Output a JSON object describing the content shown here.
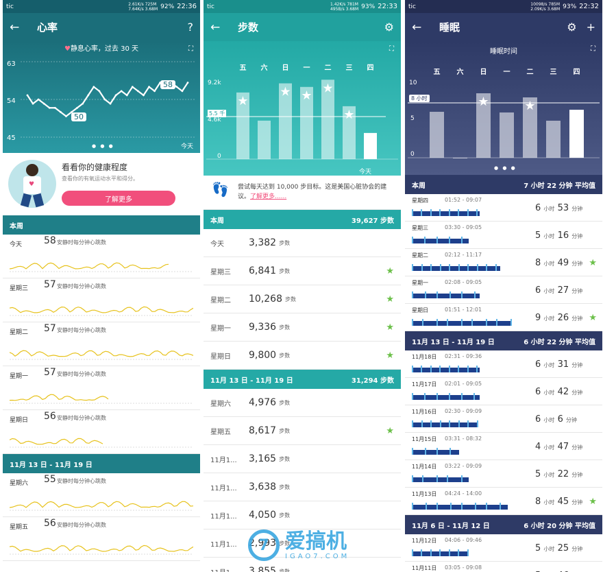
{
  "heart": {
    "status": {
      "carrier": "tic",
      "net": "2.61K/s 725M",
      "net2": "7.64K/s 3.68M",
      "battery": "92%",
      "time": "22:36"
    },
    "title": "心率",
    "help": "?",
    "chart_caption": "静息心率，过去 30 天",
    "y_ticks": [
      "63",
      "54",
      "45"
    ],
    "bubble_low": "50",
    "bubble_high": "58",
    "today": "今天",
    "chart_data": {
      "type": "line",
      "ylim": [
        45,
        63
      ],
      "values": [
        55,
        53,
        54,
        53,
        52,
        52,
        51,
        50,
        51,
        52,
        53,
        55,
        57,
        56,
        54,
        53,
        55,
        56,
        55,
        57,
        56,
        55,
        57,
        56,
        58,
        57,
        58,
        57,
        56,
        58
      ]
    },
    "promo": {
      "title": "看看你的健康程度",
      "desc": "查看你的有氧运动水平和得分。",
      "button": "了解更多"
    },
    "week_label": "本周",
    "unit": "安静时每分钟心跳数",
    "rows": [
      {
        "label": "今天",
        "value": "58",
        "fill": 0.87
      },
      {
        "label": "星期三",
        "value": "57",
        "fill": 1
      },
      {
        "label": "星期二",
        "value": "57",
        "fill": 1
      },
      {
        "label": "星期一",
        "value": "57",
        "fill": 0.55
      },
      {
        "label": "星期日",
        "value": "56",
        "fill": 0.52
      }
    ],
    "week2_label": "11月 13 日 - 11月 19 日",
    "rows2": [
      {
        "label": "星期六",
        "value": "55",
        "fill": 1
      },
      {
        "label": "星期五",
        "value": "56",
        "fill": 1
      }
    ]
  },
  "steps": {
    "status": {
      "carrier": "tic",
      "net": "1.42K/s 781M",
      "net2": "495B/s 3.68M",
      "battery": "93%",
      "time": "22:33"
    },
    "title": "步数",
    "days": [
      "五",
      "六",
      "日",
      "一",
      "二",
      "三",
      "四"
    ],
    "y_ticks": [
      "9.2k",
      "4.6k",
      "0"
    ],
    "goal_label": "5.5 千",
    "today": "今天",
    "chart_data": {
      "type": "bar",
      "categories": [
        "五",
        "六",
        "日",
        "一",
        "二",
        "三",
        "四"
      ],
      "values": [
        8617,
        4976,
        9800,
        9336,
        10268,
        6841,
        3382
      ],
      "ylim": [
        0,
        11000
      ],
      "goal": 5500
    },
    "tip": {
      "text": "尝试每天达到 10,000 步目标。这是美国心脏协会的建议。",
      "link": "了解更多......"
    },
    "week_label": "本周",
    "week_total": "39,627 步数",
    "unit": "步数",
    "rows": [
      {
        "label": "今天",
        "value": "3,382",
        "star": false
      },
      {
        "label": "星期三",
        "value": "6,841",
        "star": true
      },
      {
        "label": "星期二",
        "value": "10,268",
        "star": true
      },
      {
        "label": "星期一",
        "value": "9,336",
        "star": true
      },
      {
        "label": "星期日",
        "value": "9,800",
        "star": true
      }
    ],
    "week2_label": "11月 13 日 - 11月 19 日",
    "week2_total": "31,294 步数",
    "rows2": [
      {
        "label": "星期六",
        "value": "4,976",
        "star": false
      },
      {
        "label": "星期五",
        "value": "8,617",
        "star": true
      },
      {
        "label": "11月1...",
        "value": "3,165",
        "star": false
      },
      {
        "label": "11月1...",
        "value": "3,638",
        "star": false
      },
      {
        "label": "11月1...",
        "value": "4,050",
        "star": false
      },
      {
        "label": "11月1...",
        "value": "2,993",
        "star": false
      },
      {
        "label": "11月1...",
        "value": "3,855",
        "star": false
      }
    ]
  },
  "sleep": {
    "status": {
      "carrier": "tic",
      "net": "10098/s 785M",
      "net2": "2.09K/s 3.68M",
      "battery": "93%",
      "time": "22:32"
    },
    "title": "睡眠",
    "caption": "睡眠时间",
    "days": [
      "五",
      "六",
      "日",
      "一",
      "二",
      "三",
      "四"
    ],
    "y_ticks": [
      "10",
      "5",
      "0"
    ],
    "goal_label": "8 小时",
    "chart_data": {
      "type": "bar",
      "categories": [
        "五",
        "六",
        "日",
        "一",
        "二",
        "三",
        "四"
      ],
      "values": [
        6.7,
        0,
        9.4,
        6.6,
        8.8,
        5.4,
        7.0
      ],
      "ylim": [
        0,
        11
      ],
      "goal": 8
    },
    "hours_unit": "小时",
    "min_unit": "分钟",
    "week_label": "本周",
    "week_avg": "7 小时 22 分钟 平均值",
    "rows": [
      {
        "label": "星期四",
        "time": "01:52 - 09:07",
        "h": "6",
        "m": "53",
        "star": false,
        "fill": 0.6
      },
      {
        "label": "星期三",
        "time": "03:30 - 09:05",
        "h": "5",
        "m": "16",
        "star": false,
        "fill": 0.5
      },
      {
        "label": "星期二",
        "time": "02:12 - 11:17",
        "h": "8",
        "m": "49",
        "star": true,
        "fill": 0.78
      },
      {
        "label": "星期一",
        "time": "02:08 - 09:05",
        "h": "6",
        "m": "27",
        "star": false,
        "fill": 0.6
      },
      {
        "label": "星期日",
        "time": "01:51 - 12:01",
        "h": "9",
        "m": "26",
        "star": true,
        "fill": 0.88
      }
    ],
    "week2_label": "11月 13 日 - 11月 19 日",
    "week2_avg": "6 小时 22 分钟 平均值",
    "rows2": [
      {
        "label": "11月18日",
        "time": "02:31 - 09:36",
        "h": "6",
        "m": "31",
        "star": false,
        "fill": 0.6
      },
      {
        "label": "11月17日",
        "time": "02:01 - 09:05",
        "h": "6",
        "m": "42",
        "star": false,
        "fill": 0.6
      },
      {
        "label": "11月16日",
        "time": "02:30 - 09:09",
        "h": "6",
        "m": "6",
        "star": false,
        "fill": 0.58
      },
      {
        "label": "11月15日",
        "time": "03:31 - 08:32",
        "h": "4",
        "m": "47",
        "star": false,
        "fill": 0.42
      },
      {
        "label": "11月14日",
        "time": "03:22 - 09:09",
        "h": "5",
        "m": "22",
        "star": false,
        "fill": 0.5
      },
      {
        "label": "11月13日",
        "time": "04:24 - 14:00",
        "h": "8",
        "m": "45",
        "star": true,
        "fill": 0.85
      }
    ],
    "week3_label": "11月 6 日 - 11月 12 日",
    "week3_avg": "6 小时 20 分钟 平均值",
    "rows3": [
      {
        "label": "11月12日",
        "time": "04:06 - 09:46",
        "h": "5",
        "m": "25",
        "star": false,
        "fill": 0.5
      },
      {
        "label": "11月11日",
        "time": "03:05 - 09:08",
        "h": "5",
        "m": "46",
        "star": false,
        "fill": 0.52
      }
    ]
  },
  "watermark": {
    "brand": "爱搞机",
    "url": "IGAO7.COM"
  },
  "colors": {
    "heart": "#1f7f88",
    "steps": "#25a9a6",
    "sleep": "#2e3a66",
    "star": "#6cc04a"
  }
}
